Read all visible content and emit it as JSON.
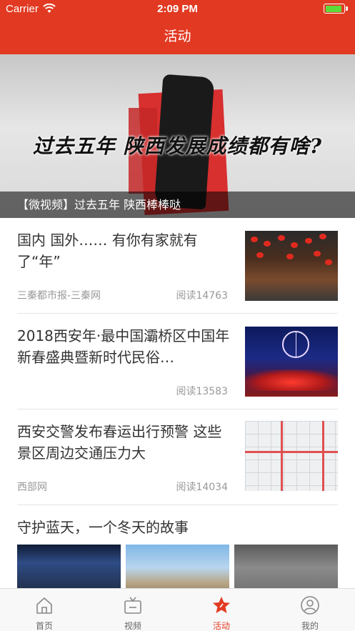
{
  "status_bar": {
    "carrier": "Carrier",
    "time": "2:09 PM",
    "battery_level": 0.92
  },
  "nav": {
    "title": "活动"
  },
  "banner": {
    "calligraphy_text": "过去五年 陕西发展成绩都有啥?",
    "caption": "【微视频】过去五年 陕西棒棒哒"
  },
  "news": [
    {
      "title": "国内 国外…… 有你有家就有了“年”",
      "source": "三秦都市报-三秦网",
      "reads": "阅读14763",
      "thumb_icon": "lanterns-street-photo"
    },
    {
      "title": "2018西安年·最中国灞桥区中国年新春盛典暨新时代民俗…",
      "source": "",
      "reads": "阅读13583",
      "thumb_icon": "night-ferris-wheel-photo"
    },
    {
      "title": "西安交警发布春运出行预警 这些景区周边交通压力大",
      "source": "西部网",
      "reads": "阅读14034",
      "thumb_icon": "traffic-map-image"
    }
  ],
  "section4": {
    "title": "守护蓝天，一个冬天的故事"
  },
  "tabbar": {
    "tabs": [
      {
        "label": "首页",
        "icon": "home-icon"
      },
      {
        "label": "视频",
        "icon": "tv-icon"
      },
      {
        "label": "活动",
        "icon": "star-icon",
        "active": true
      },
      {
        "label": "我的",
        "icon": "profile-icon"
      }
    ],
    "accent": "#e23a22"
  },
  "colors": {
    "header_bg": "#e23a22",
    "text_primary": "#333333",
    "text_secondary": "#999999"
  }
}
